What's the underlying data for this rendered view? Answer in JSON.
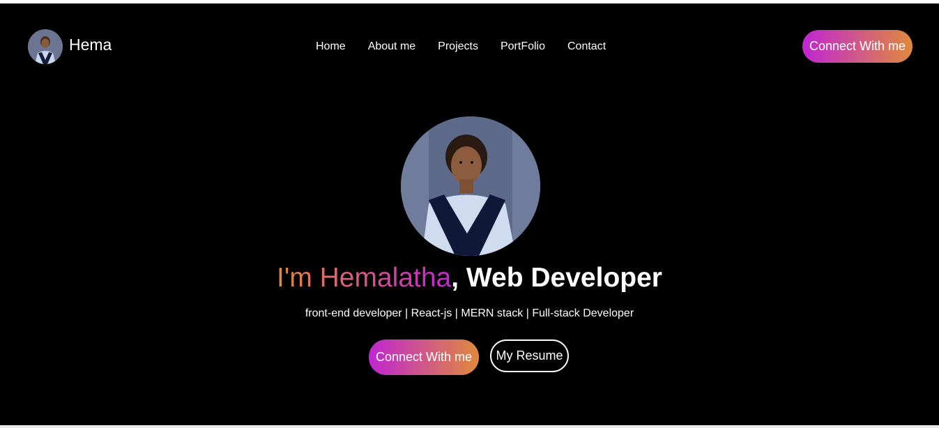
{
  "brand": {
    "name": "Hema",
    "avatar_icon": "profile-photo"
  },
  "nav": {
    "links": [
      "Home",
      "About me",
      "Projects",
      "PortFolio",
      "Contact"
    ],
    "connect_label": "Connect With me"
  },
  "hero": {
    "photo_icon": "profile-photo",
    "title_prefix": "I'm Hemalatha",
    "title_suffix": ", Web Developer",
    "subtitle": "front-end developer | React-js | MERN stack | Full-stack Developer",
    "connect_label": "Connect With me",
    "resume_label": "My Resume"
  },
  "colors": {
    "background": "#000000",
    "text": "#ffffff",
    "gradient_start": "#c026d3",
    "gradient_end": "#df8a3c"
  }
}
